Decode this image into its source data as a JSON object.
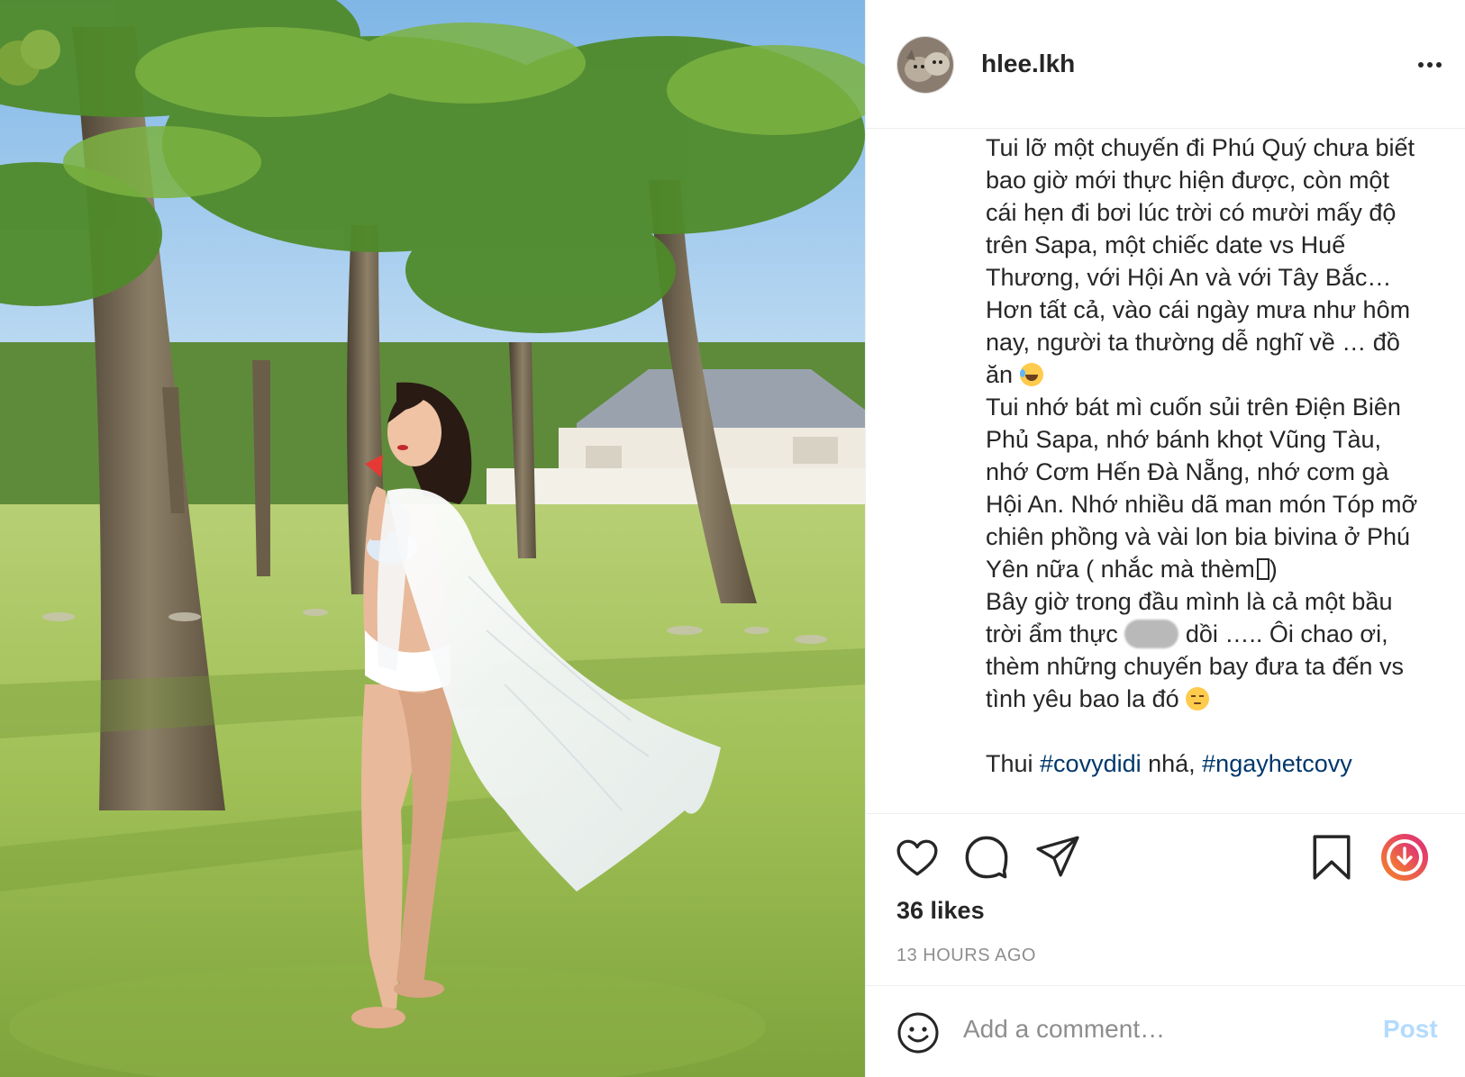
{
  "post": {
    "username": "hlee.lkh",
    "caption_lines": [
      "Tui lỡ một chuyến đi Phú Quý chưa biết",
      "bao giờ mới thực hiện được, còn một",
      "cái hẹn đi bơi lúc trời có mười mấy độ",
      "trên Sapa, một chiếc date vs Huế",
      "Thương, với Hội An và với Tây Bắc…",
      "Hơn tất cả, vào cái ngày mưa như hôm",
      "nay, người ta thường dễ nghĩ về … đồ",
      "ăn",
      "Tui nhớ bát mì cuốn sủi trên Điện Biên",
      "Phủ Sapa, nhớ bánh khọt Vũng Tàu,",
      "nhớ Cơm Hến Đà Nẵng, nhớ cơm gà",
      "Hội An. Nhớ nhiều dã man món Tóp mỡ",
      "chiên phồng và vài lon bia bivina ở Phú",
      "Yên nữa ( nhắc mà thèm",
      "Bây giờ trong đầu mình là cả một bầu",
      "trời ẩm thực",
      "dồi ….. Ôi chao ơi,",
      "thèm những chuyến bay đưa ta đến vs",
      "tình yêu bao la đó"
    ],
    "caption_close_paren": ")",
    "caption_final_prefix": "Thui ",
    "hashtag_1": "#covydidi",
    "caption_final_middle": " nhá, ",
    "hashtag_2": "#ngayhetcovy",
    "likes": "36 likes",
    "time_ago": "13 HOURS AGO"
  },
  "comment": {
    "placeholder": "Add a comment…",
    "post_label": "Post"
  },
  "icons": {
    "more": "more-horizontal-icon",
    "like": "heart-icon",
    "comment": "comment-bubble-icon",
    "share": "paper-plane-icon",
    "save": "bookmark-icon",
    "download": "download-icon",
    "emoji": "smiley-icon"
  },
  "colors": {
    "hashtag": "#00376b",
    "post_disabled": "#b3dbff",
    "muted": "#8e8e8e",
    "download_gradient_start": "#f58529",
    "download_gradient_end": "#dd2a7b"
  }
}
